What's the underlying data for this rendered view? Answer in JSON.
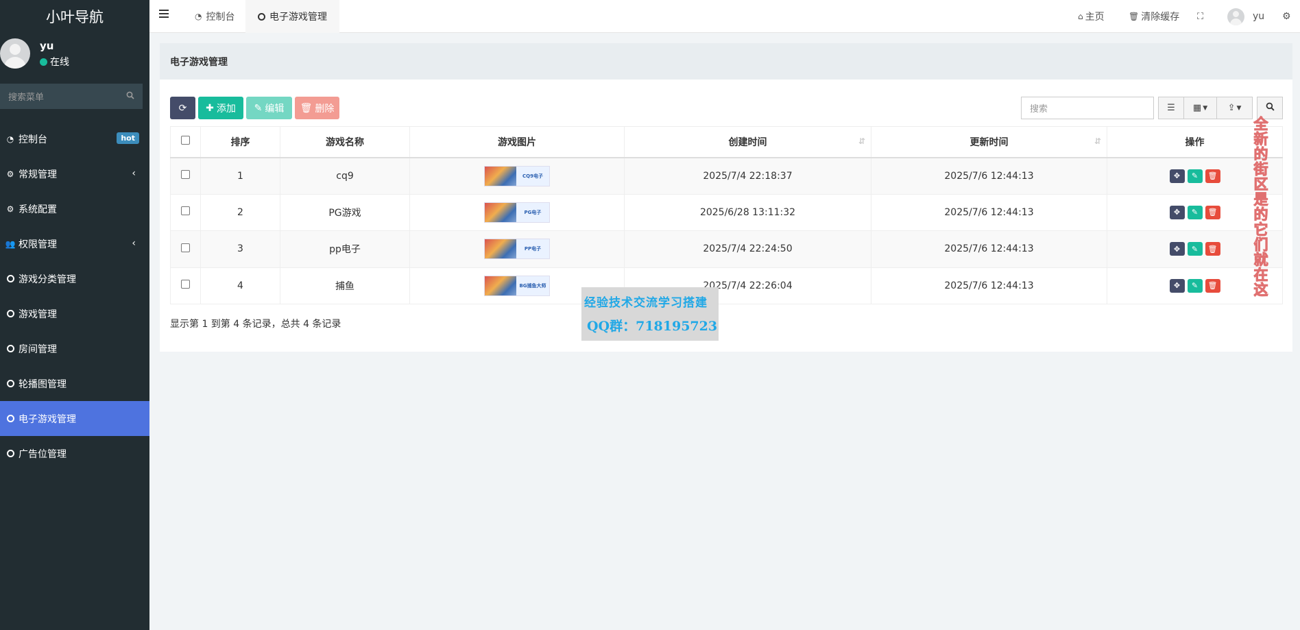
{
  "brand": "小叶导航",
  "user": {
    "name": "yu",
    "status": "在线"
  },
  "sidebar": {
    "search_placeholder": "搜索菜单",
    "items": [
      {
        "label": "控制台",
        "icon": "dashboard-icon",
        "badge": "hot"
      },
      {
        "label": "常规管理",
        "icon": "cogs-icon",
        "expandable": true
      },
      {
        "label": "系统配置",
        "icon": "gear-icon"
      },
      {
        "label": "权限管理",
        "icon": "users-icon",
        "expandable": true
      },
      {
        "label": "游戏分类管理",
        "icon": "circle-icon"
      },
      {
        "label": "游戏管理",
        "icon": "circle-icon"
      },
      {
        "label": "房间管理",
        "icon": "circle-icon"
      },
      {
        "label": "轮播图管理",
        "icon": "circle-icon"
      },
      {
        "label": "电子游戏管理",
        "icon": "circle-icon",
        "active": true
      },
      {
        "label": "广告位管理",
        "icon": "circle-icon"
      }
    ]
  },
  "topbar": {
    "tabs": [
      {
        "label": "控制台",
        "icon": "dashboard-icon"
      },
      {
        "label": "电子游戏管理",
        "icon": "circle-icon",
        "active": true
      }
    ],
    "home": "主页",
    "clear_cache": "清除缓存",
    "user_name": "yu"
  },
  "panel": {
    "title": "电子游戏管理",
    "toolbar": {
      "add": "添加",
      "edit": "编辑",
      "delete": "删除",
      "search_placeholder": "搜索"
    },
    "table": {
      "headers": [
        "排序",
        "游戏名称",
        "游戏图片",
        "创建时间",
        "更新时间",
        "操作"
      ],
      "rows": [
        {
          "sort": "1",
          "name": "cq9",
          "image_label": "CQ9电子",
          "created": "2025/7/4 22:18:37",
          "updated": "2025/7/6 12:44:13"
        },
        {
          "sort": "2",
          "name": "PG游戏",
          "image_label": "PG电子",
          "created": "2025/6/28 13:11:32",
          "updated": "2025/7/6 12:44:13"
        },
        {
          "sort": "3",
          "name": "pp电子",
          "image_label": "PP电子",
          "created": "2025/7/4 22:24:50",
          "updated": "2025/7/6 12:44:13"
        },
        {
          "sort": "4",
          "name": "捕鱼",
          "image_label": "BG捕鱼大师",
          "created": "2025/7/4 22:26:04",
          "updated": "2025/7/6 12:44:13"
        }
      ]
    },
    "pagination_info": "显示第 1 到第 4 条记录，总共 4 条记录"
  },
  "overlay": {
    "watermark_line1": "经验技术交流学习搭建",
    "watermark_line2": "QQ群：718195723",
    "vertical_text": "全新的街区 是的 它们就在这"
  }
}
